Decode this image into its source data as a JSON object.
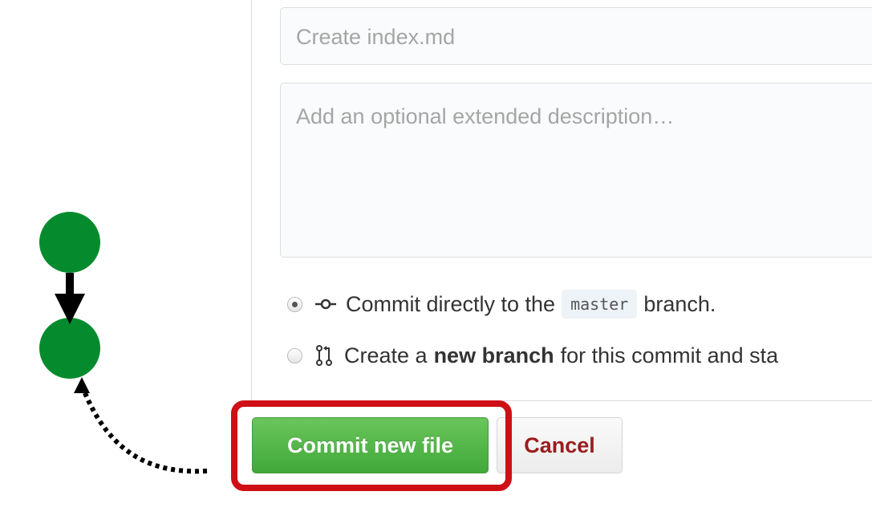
{
  "form": {
    "commit_title_placeholder": "Create index.md",
    "description_placeholder": "Add an optional extended description…",
    "options": [
      {
        "text_before": "Commit directly to the",
        "branch": "master",
        "text_after": "branch.",
        "selected": true
      },
      {
        "text_before": "Create a",
        "strong": "new branch",
        "text_after": "for this commit and sta",
        "selected": false
      }
    ],
    "commit_button": "Commit new file",
    "cancel_button": "Cancel"
  },
  "colors": {
    "commit_green": "#41a83a",
    "cancel_red": "#9a1c1c",
    "highlight_red": "#cf0f16",
    "node_green": "#058b2e"
  },
  "diagram": {
    "nodes": 2,
    "description_icons": [
      "commit-node-icon",
      "commit-node-icon",
      "arrow-down-icon",
      "dotted-curved-arrow-icon"
    ]
  }
}
